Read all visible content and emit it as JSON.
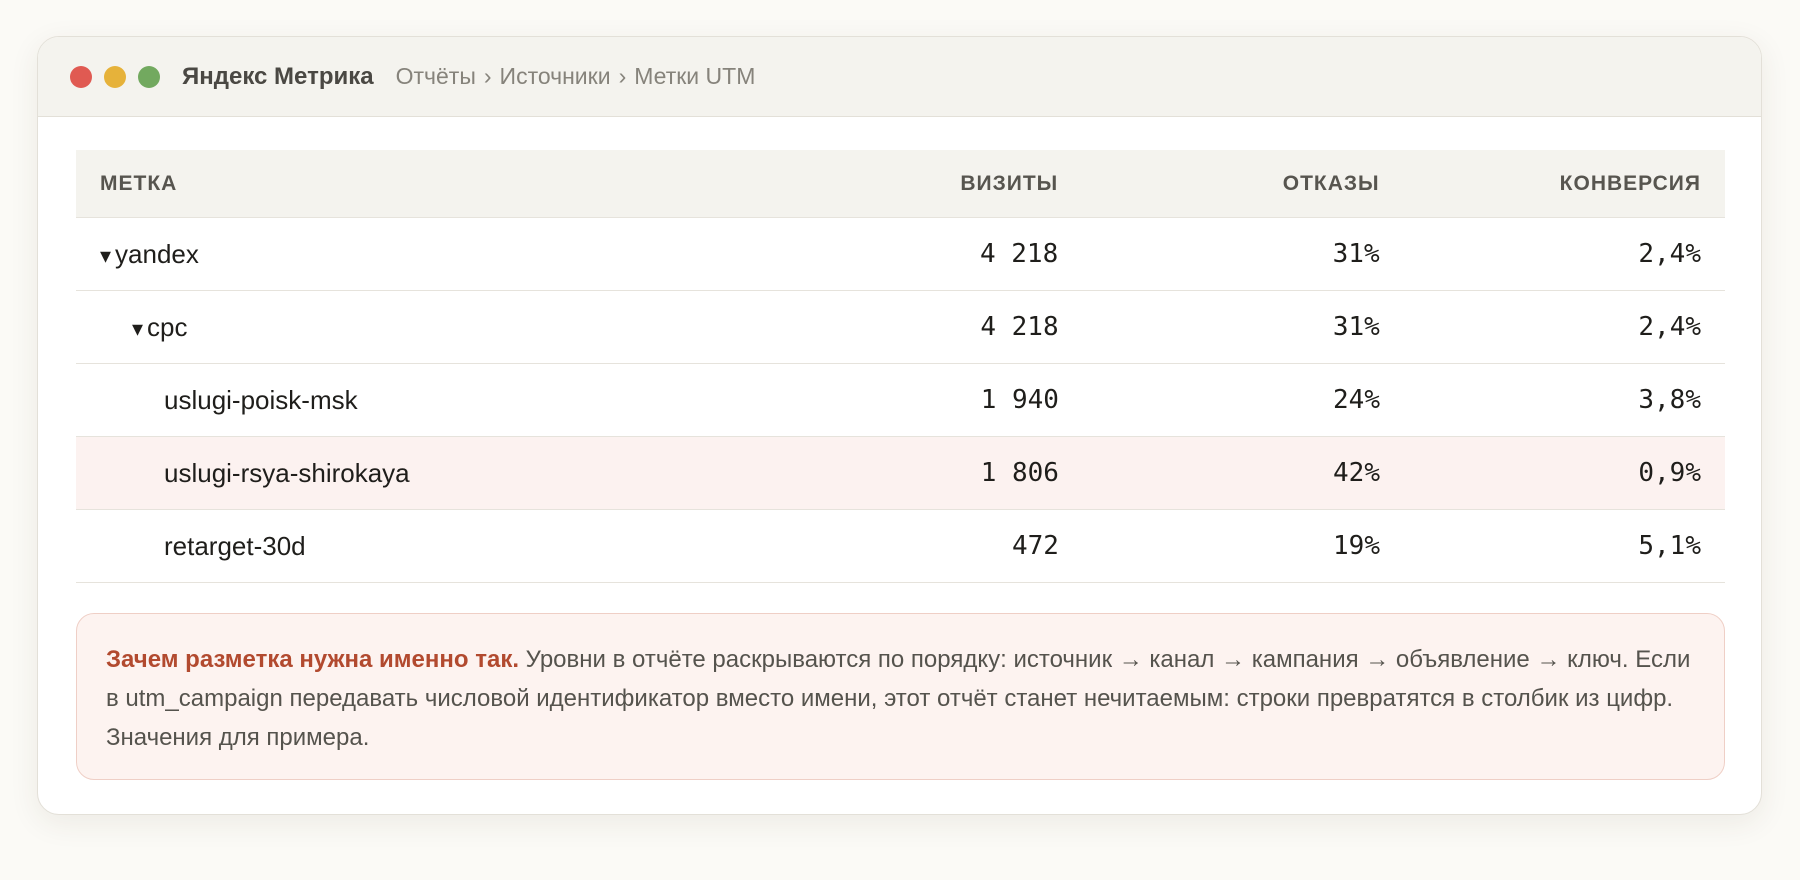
{
  "window": {
    "app_title": "Яндекс Метрика",
    "breadcrumb": [
      "Отчёты",
      "Источники",
      "Метки UTM"
    ],
    "breadcrumb_sep": "›"
  },
  "table": {
    "columns": [
      "МЕТКА",
      "ВИЗИТЫ",
      "ОТКАЗЫ",
      "КОНВЕРСИЯ"
    ],
    "rows": [
      {
        "label": "yandex",
        "caret": "▾",
        "visits": "4 218",
        "bounce": "31%",
        "conversion": "2,4%"
      },
      {
        "label": "cpc",
        "caret": "▾",
        "visits": "4 218",
        "bounce": "31%",
        "conversion": "2,4%"
      },
      {
        "label": "uslugi-poisk-msk",
        "visits": "1 940",
        "bounce": "24%",
        "conversion": "3,8%"
      },
      {
        "label": "uslugi-rsya-shirokaya",
        "visits": "1 806",
        "bounce": "42%",
        "conversion": "0,9%"
      },
      {
        "label": "retarget-30d",
        "visits": "472",
        "bounce": "19%",
        "conversion": "5,1%"
      }
    ]
  },
  "note": {
    "lead": "Зачем разметка нужна именно так.",
    "text": " Уровни в отчёте раскрываются по порядку: источник → канал → кампания → объявление → ключ. Если в utm_campaign передавать числовой идентификатор вместо имени, этот отчёт станет нечитаемым: строки превратятся в столбик из цифр. Значения для примера."
  },
  "colors": {
    "accent": "#b24a2f",
    "highlight_row": "#fcf2f0",
    "note_bg": "#fdf3f0"
  }
}
